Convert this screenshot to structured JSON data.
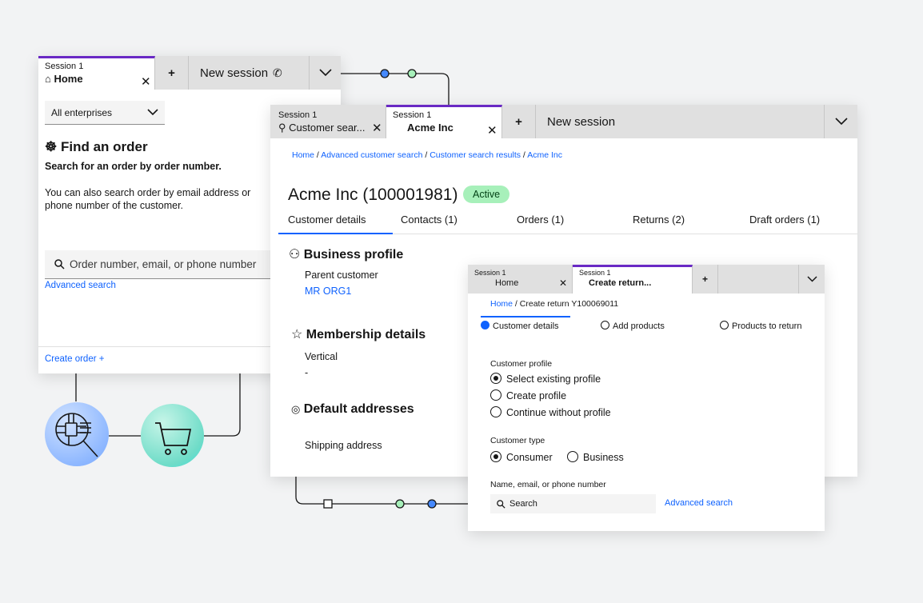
{
  "panel1": {
    "tab1": {
      "session": "Session 1",
      "name": "Home"
    },
    "new_session": "New session",
    "enterprise_select": "All enterprises",
    "title": "Find an order",
    "subtitle": "Search for an order by order number.",
    "description": "You can also search order by email address or phone number of the customer.",
    "search_placeholder": "Order number, email, or phone number",
    "advanced_search": "Advanced search",
    "create_order": "Create order +"
  },
  "panel2": {
    "tab1": {
      "session": "Session 1",
      "name": "Customer sear..."
    },
    "tab2": {
      "session": "Session 1",
      "name": "Acme Inc"
    },
    "new_session": "New session",
    "breadcrumb": [
      "Home",
      "Advanced customer search",
      "Customer search results",
      "Acme Inc"
    ],
    "title": "Acme Inc (100001981)",
    "status": "Active",
    "tabs": [
      "Customer details",
      "Contacts (1)",
      "Orders (1)",
      "Returns (2)",
      "Draft orders (1)"
    ],
    "business_profile": "Business profile",
    "parent_customer_label": "Parent customer",
    "parent_customer_value": "MR ORG1",
    "membership": "Membership details",
    "vertical_label": "Vertical",
    "vertical_value": "-",
    "default_addresses": "Default addresses",
    "shipping_address": "Shipping address"
  },
  "panel3": {
    "tab1": {
      "session": "Session 1",
      "name": "Home"
    },
    "tab2": {
      "session": "Session 1",
      "name": "Create return..."
    },
    "breadcrumb_home": "Home",
    "breadcrumb_current": "Create return Y100069011",
    "steps": [
      "Customer details",
      "Add products",
      "Products to return"
    ],
    "customer_profile_label": "Customer profile",
    "profile_options": [
      "Select existing profile",
      "Create profile",
      "Continue without profile"
    ],
    "customer_type_label": "Customer type",
    "type_options": [
      "Consumer",
      "Business"
    ],
    "name_label": "Name, email, or phone number",
    "search_placeholder": "Search",
    "advanced_search": "Advanced search"
  },
  "colors": {
    "accent": "#6929c4",
    "link": "#0f62fe",
    "active_tag": "#a7f0ba",
    "node_blue": "#4589ff",
    "node_green": "#a7f0ba"
  },
  "icons": [
    "home-icon",
    "close-icon",
    "phone-icon",
    "chevron-down-icon",
    "search-icon",
    "network-icon",
    "user-profile-icon",
    "star-icon",
    "location-icon",
    "cart-icon",
    "circuit-icon"
  ]
}
